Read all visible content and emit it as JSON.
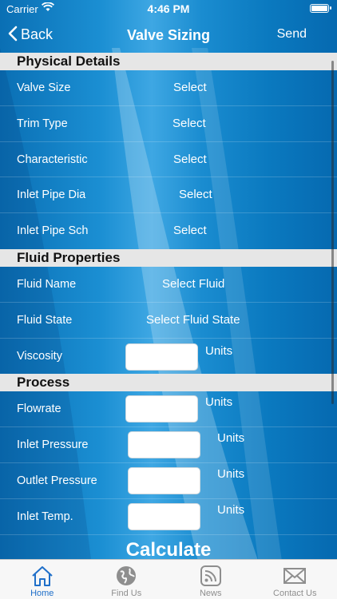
{
  "status_bar": {
    "carrier": "Carrier",
    "time": "4:46 PM"
  },
  "nav": {
    "back_label": "Back",
    "title": "Valve Sizing",
    "send_label": "Send"
  },
  "sections": {
    "physical": {
      "title": "Physical Details",
      "rows": [
        {
          "label": "Valve Size",
          "value": "Select"
        },
        {
          "label": "Trim Type",
          "value": "Select"
        },
        {
          "label": "Characteristic",
          "value": "Select"
        },
        {
          "label": "Inlet Pipe Dia",
          "value": "Select"
        },
        {
          "label": "Inlet Pipe Sch",
          "value": "Select"
        }
      ]
    },
    "fluid": {
      "title": "Fluid Properties",
      "rows": [
        {
          "label": "Fluid Name",
          "value": "Select Fluid"
        },
        {
          "label": "Fluid State",
          "value": "Select Fluid State"
        },
        {
          "label": "Viscosity",
          "input_value": "",
          "units": "Units"
        }
      ]
    },
    "process": {
      "title": "Process",
      "rows": [
        {
          "label": "Flowrate",
          "input_value": "",
          "units": "Units"
        },
        {
          "label": "Inlet Pressure",
          "input_value": "",
          "units": "Units"
        },
        {
          "label": "Outlet Pressure",
          "input_value": "",
          "units": "Units"
        },
        {
          "label": "Inlet Temp.",
          "input_value": "",
          "units": "Units"
        }
      ]
    }
  },
  "calculate_label": "Calculate",
  "tabs": [
    {
      "label": "Home",
      "icon": "home-icon",
      "active": true
    },
    {
      "label": "Find Us",
      "icon": "globe-icon",
      "active": false
    },
    {
      "label": "News",
      "icon": "rss-icon",
      "active": false
    },
    {
      "label": "Contact Us",
      "icon": "envelope-icon",
      "active": false
    }
  ],
  "colors": {
    "background_blue": "#0a7ec2",
    "section_header_bg": "#e6e6e6",
    "tab_active": "#1f6fc9",
    "tab_inactive": "#8e8e8e"
  }
}
